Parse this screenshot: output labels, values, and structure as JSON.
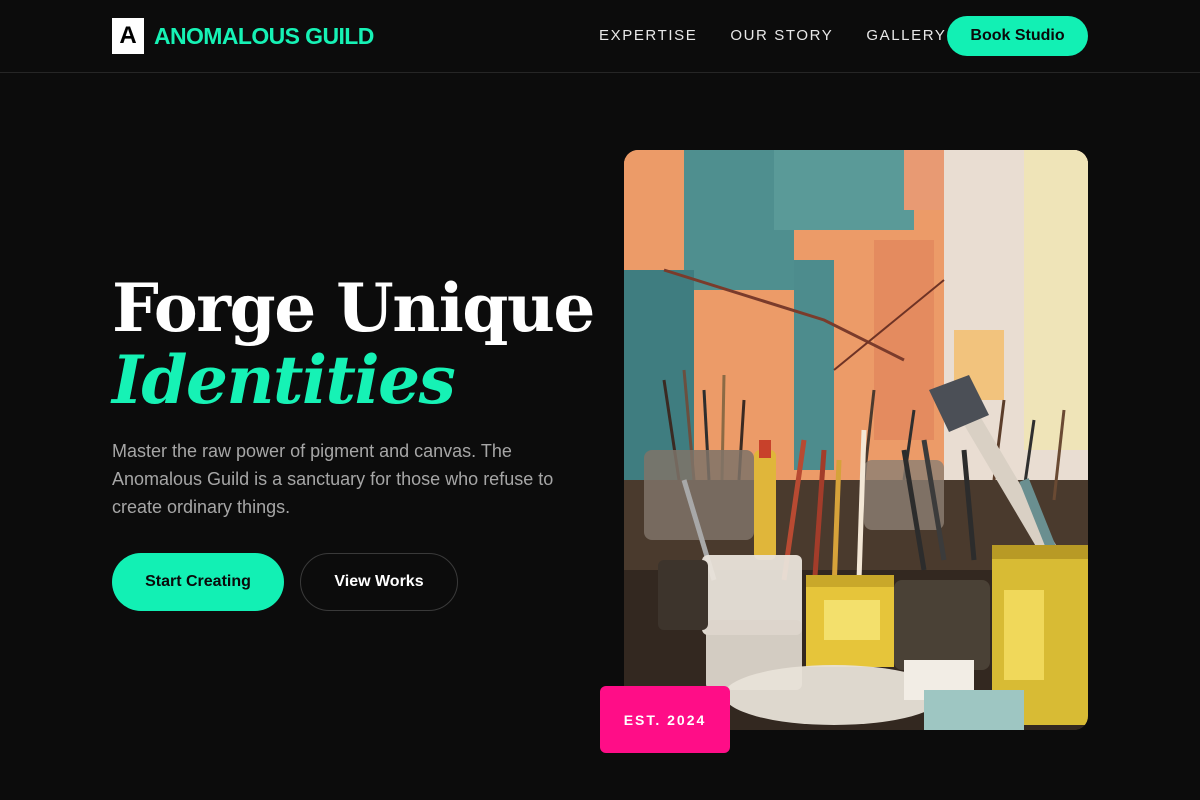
{
  "header": {
    "logo_mark": "A",
    "brand_name": "ANOMALOUS GUILD",
    "nav": [
      "EXPERTISE",
      "OUR STORY",
      "GALLERY"
    ],
    "cta_label": "Book Studio"
  },
  "hero": {
    "title_line1": "Forge Unique",
    "title_line2": "Identities",
    "description": "Master the raw power of pigment and canvas. The Anomalous Guild is a sanctuary for those who refuse to create ordinary things.",
    "primary_button": "Start Creating",
    "secondary_button": "View Works",
    "badge": "EST. 2024"
  },
  "colors": {
    "accent": "#12f0b4",
    "badge": "#ff0d87",
    "background": "#0c0c0c"
  }
}
